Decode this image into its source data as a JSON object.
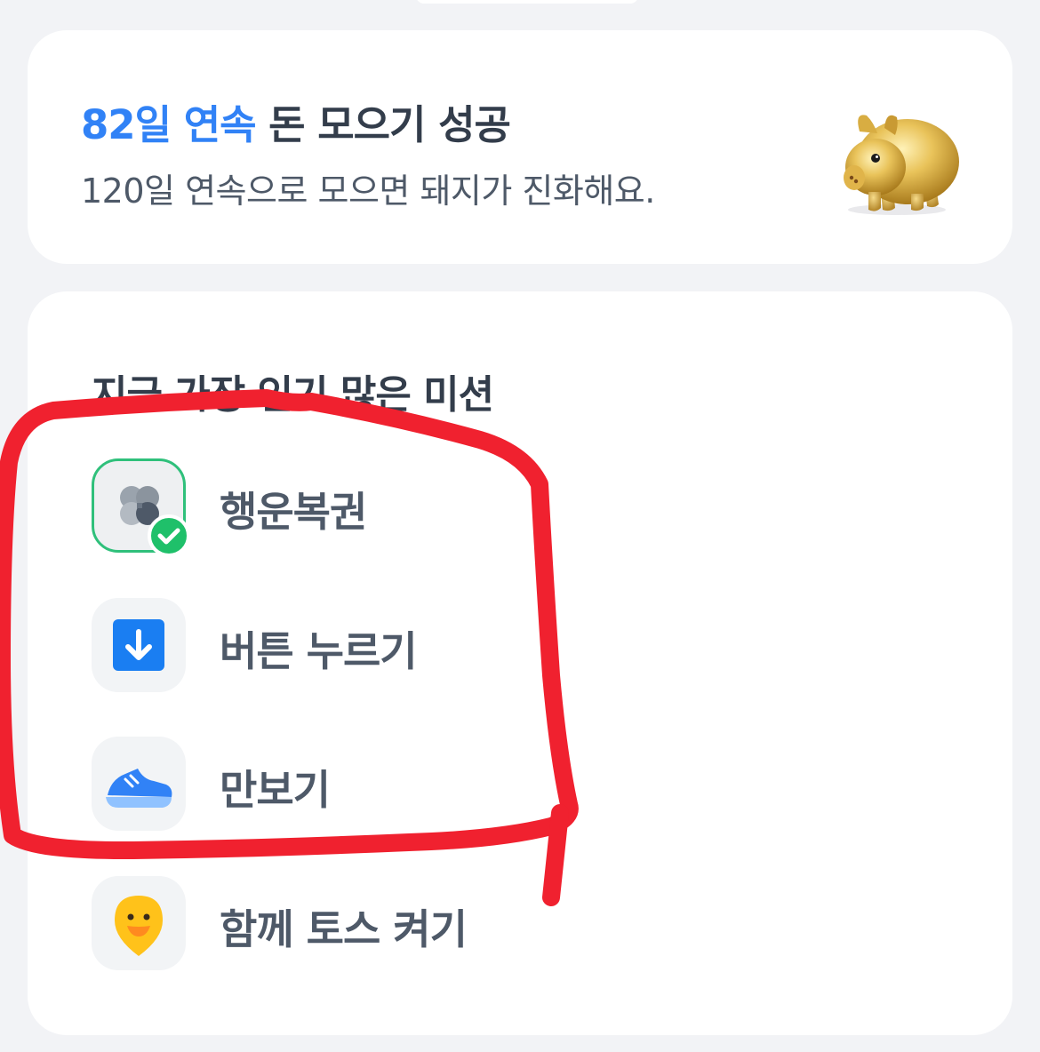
{
  "streak": {
    "highlight": "82일 연속",
    "title_rest": " 돈 모으기 성공",
    "subtitle": "120일 연속으로 모으면 돼지가 진화해요.",
    "image": "gold-piggy-bank"
  },
  "missions": {
    "heading": "지금 가장 인기 많은 미션",
    "items": [
      {
        "label": "행운복권",
        "icon": "clover-icon",
        "completed": true
      },
      {
        "label": "버튼 누르기",
        "icon": "arrow-down-button-icon",
        "completed": false
      },
      {
        "label": "만보기",
        "icon": "sneaker-icon",
        "completed": false
      },
      {
        "label": "함께 토스 켜기",
        "icon": "chick-pin-icon",
        "completed": false
      }
    ]
  },
  "colors": {
    "background": "#f2f3f6",
    "card": "#ffffff",
    "accent": "#3182f6",
    "success": "#1fc06a",
    "annotation": "#f0212f"
  }
}
